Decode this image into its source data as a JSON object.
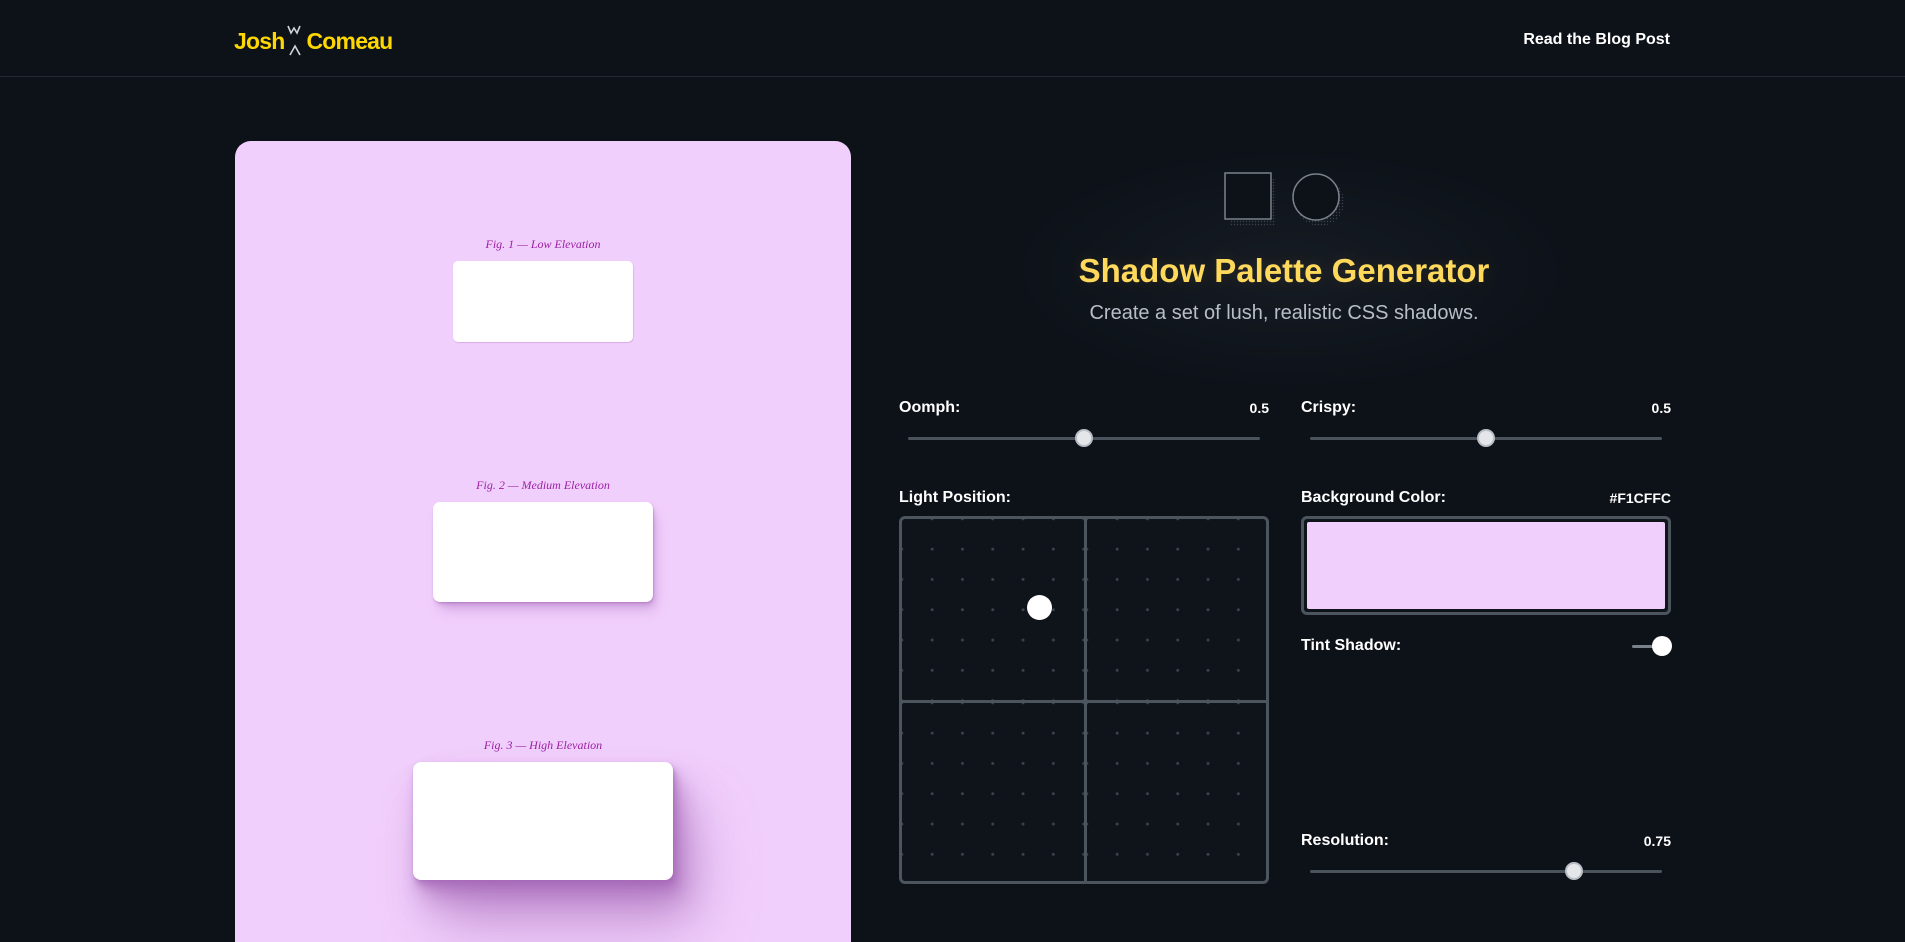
{
  "header": {
    "logo_part1": "Josh",
    "logo_part2": "Comeau",
    "nav_link": "Read the Blog Post"
  },
  "preview": {
    "background_color": "#F1CFFC",
    "figures": [
      {
        "caption": "Fig. 1 — Low Elevation"
      },
      {
        "caption": "Fig. 2 — Medium Elevation"
      },
      {
        "caption": "Fig. 3 — High Elevation"
      }
    ]
  },
  "hero": {
    "title": "Shadow Palette Generator",
    "subtitle": "Create a set of lush, realistic CSS shadows."
  },
  "controls": {
    "oomph": {
      "label": "Oomph:",
      "value": "0.5",
      "fraction": 0.5
    },
    "crispy": {
      "label": "Crispy:",
      "value": "0.5",
      "fraction": 0.5
    },
    "light_position": {
      "label": "Light Position:"
    },
    "background_color": {
      "label": "Background Color:",
      "value": "#F1CFFC"
    },
    "tint_shadow": {
      "label": "Tint Shadow:",
      "enabled": true
    },
    "resolution": {
      "label": "Resolution:",
      "value": "0.75",
      "fraction": 0.75
    }
  },
  "colors": {
    "page_bg": "#0d1219",
    "accent": "#ffd700",
    "title": "#ffd95c",
    "caption": "#9b1fa3"
  }
}
